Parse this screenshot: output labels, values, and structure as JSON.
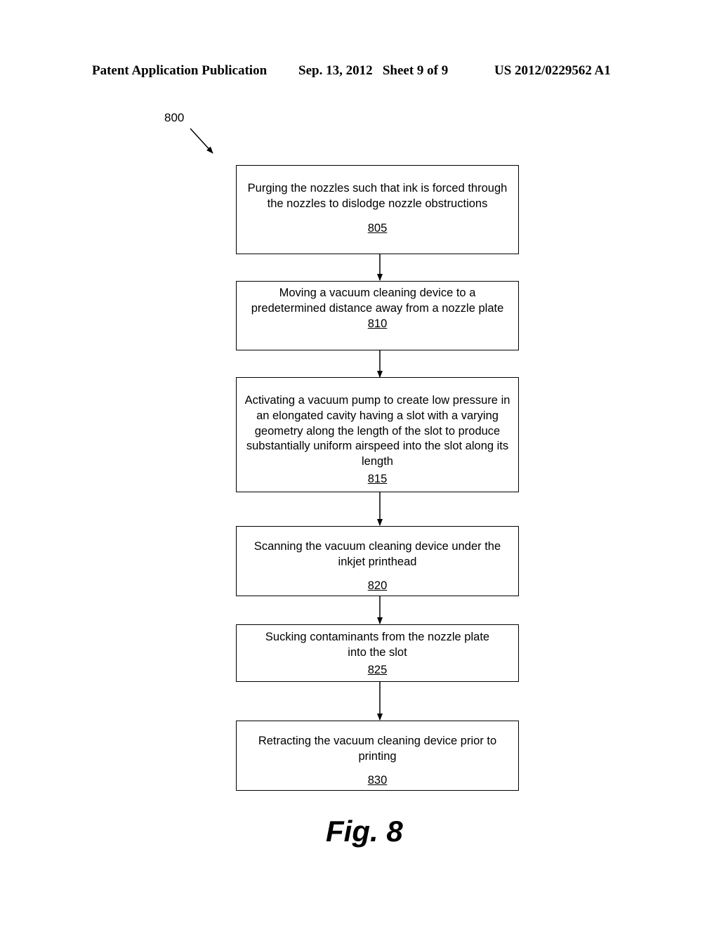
{
  "header": {
    "publication": "Patent Application Publication",
    "date_sheet": "Sep. 13, 2012   Sheet 9 of 9",
    "number": "US 2012/0229562 A1"
  },
  "diagram": {
    "ref_label": "800",
    "steps": [
      {
        "text": "Purging the nozzles such that ink is forced through the nozzles to dislodge nozzle obstructions",
        "ref": "805"
      },
      {
        "text": "Moving a vacuum cleaning device to a predetermined distance away from a nozzle plate",
        "ref": "810"
      },
      {
        "text": "Activating a vacuum pump to create low pressure in an elongated cavity having a slot with a varying geometry along the length of the slot to produce substantially uniform airspeed into the slot along its length",
        "ref": "815"
      },
      {
        "text": "Scanning the vacuum cleaning device under the inkjet printhead",
        "ref": "820"
      },
      {
        "text": "Sucking contaminants from the nozzle plate into the slot",
        "ref": "825"
      },
      {
        "text": "Retracting the vacuum cleaning device prior to printing",
        "ref": "830"
      }
    ],
    "figure_label": "Fig. 8"
  }
}
